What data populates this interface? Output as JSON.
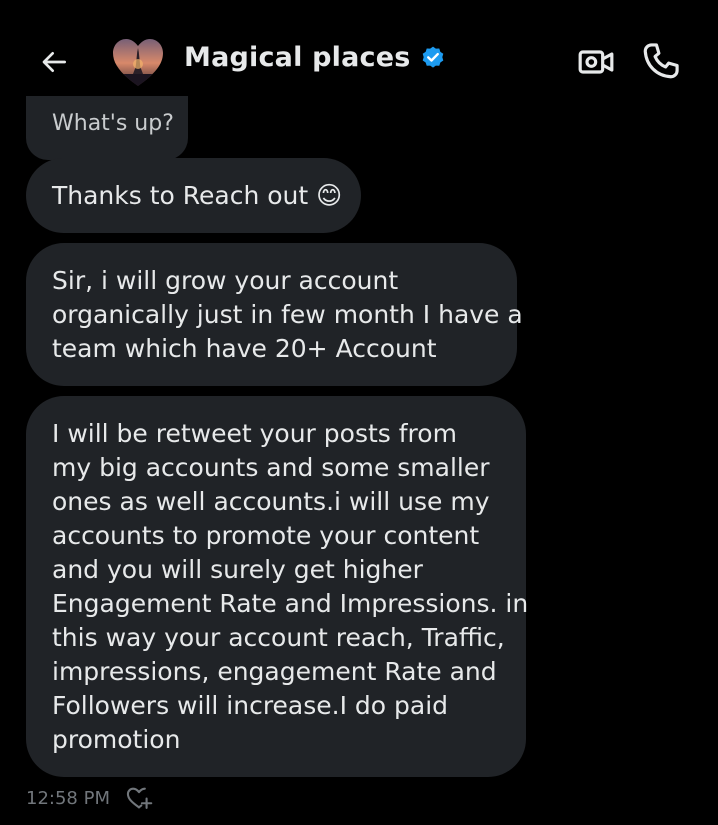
{
  "header": {
    "title": "Magical places",
    "back_icon": "arrow-left-icon",
    "verified_icon": "verified-badge-icon",
    "video_icon": "video-camera-icon",
    "call_icon": "phone-icon"
  },
  "messages": [
    {
      "text_lines": [
        "What's up?"
      ]
    },
    {
      "text_lines": [
        "Thanks to Reach out 😊"
      ]
    },
    {
      "text_lines": [
        "Sir, i will grow your account",
        "organically just in few month I have a",
        "team which have 20+ Account"
      ]
    },
    {
      "text_lines": [
        "I will be retweet your posts from",
        "my big accounts and some smaller",
        "ones as well accounts.i will use my",
        "accounts to promote your content",
        "and you will surely get higher",
        "Engagement Rate and Impressions. in",
        "this way your account reach, Traffic,",
        "impressions, engagement Rate and",
        "Followers will increase.I do paid",
        "promotion"
      ]
    }
  ],
  "meta": {
    "timestamp": "12:58 PM",
    "reaction_icon": "add-reaction-heart-icon"
  },
  "colors": {
    "background": "#000000",
    "bubble": "#202327",
    "text": "#e7e9ea",
    "muted": "#71767b",
    "verified": "#1d9bf0"
  }
}
